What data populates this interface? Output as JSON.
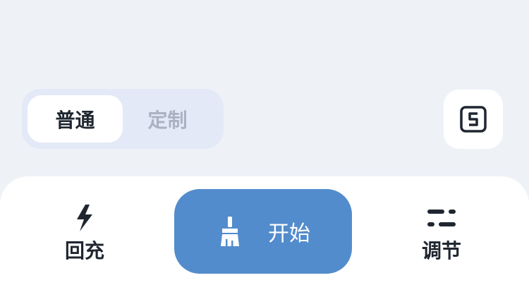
{
  "mode_tabs": {
    "normal": "普通",
    "custom": "定制",
    "selected": "普通"
  },
  "actions": {
    "recharge": {
      "label": "回充",
      "icon": "lightning-bolt-icon"
    },
    "start": {
      "label": "开始",
      "icon": "broom-icon"
    },
    "adjust": {
      "label": "调节",
      "icon": "adjust-sliders-icon"
    }
  },
  "icons": {
    "map_button": "map-mode-icon"
  },
  "colors": {
    "background": "#eef2f7",
    "primary": "#538ccc",
    "text_dark": "#1f2630",
    "text_muted": "#aab2c2",
    "segment_bg": "#e3e9f6"
  }
}
